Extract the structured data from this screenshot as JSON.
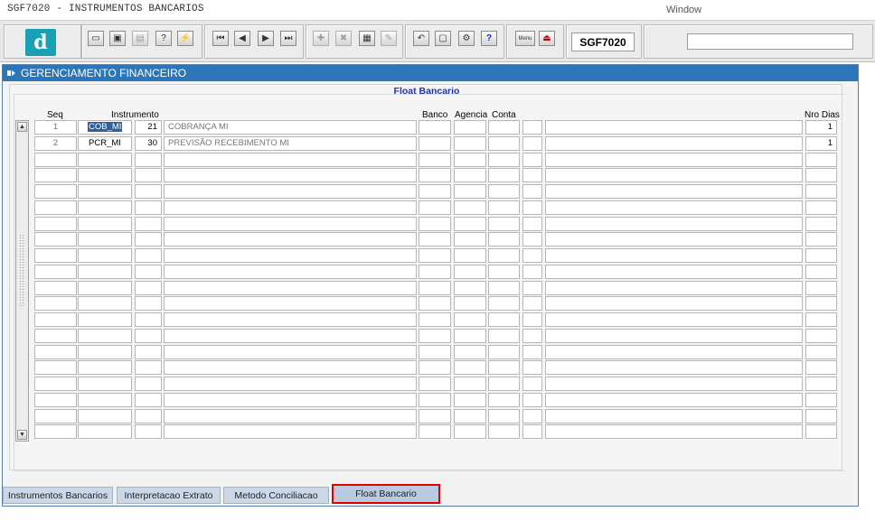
{
  "window": {
    "title": "SGF7020 - INSTRUMENTOS BANCARIOS",
    "menu_window": "Window"
  },
  "toolbar": {
    "logo_letter": "d",
    "form_code": "SGF7020",
    "search_value": "",
    "buttons": [
      {
        "name": "save-icon",
        "glyph": "▭"
      },
      {
        "name": "screen-icon",
        "glyph": "▣"
      },
      {
        "name": "print-icon",
        "glyph": "▤"
      },
      {
        "name": "query-enter-icon",
        "glyph": "?"
      },
      {
        "name": "query-execute-icon",
        "glyph": "⚡"
      },
      {
        "name": "first-record-icon",
        "glyph": "⏮"
      },
      {
        "name": "previous-record-icon",
        "glyph": "◀"
      },
      {
        "name": "next-record-icon",
        "glyph": "▶"
      },
      {
        "name": "last-record-icon",
        "glyph": "⏭"
      },
      {
        "name": "insert-record-icon",
        "glyph": "✚"
      },
      {
        "name": "delete-record-icon",
        "glyph": "✖"
      },
      {
        "name": "clear-record-icon",
        "glyph": "▦"
      },
      {
        "name": "edit-icon",
        "glyph": "✎"
      },
      {
        "name": "undo-icon",
        "glyph": "↶"
      },
      {
        "name": "list-icon",
        "glyph": "▢"
      },
      {
        "name": "tools-icon",
        "glyph": "⚙"
      },
      {
        "name": "help-icon",
        "glyph": "?"
      },
      {
        "name": "menu-icon",
        "glyph": "Menu"
      },
      {
        "name": "exit-icon",
        "glyph": "⏏"
      }
    ]
  },
  "frame": {
    "title": "GERENCIAMENTO FINANCEIRO"
  },
  "panel": {
    "title": "Float Bancario"
  },
  "columns": {
    "seq": "Seq",
    "instrumento": "Instrumento",
    "banco": "Banco",
    "agencia": "Agencia",
    "conta": "Conta",
    "nro_dias": "Nro Dias"
  },
  "rows": [
    {
      "seq": "1",
      "code": "COB_MI",
      "num": "21",
      "desc": "COBRANÇA MI",
      "banco": "",
      "agencia": "",
      "conta": "",
      "dig": "",
      "extra": "",
      "dias": "1"
    },
    {
      "seq": "2",
      "code": "PCR_MI",
      "num": "30",
      "desc": "PREVISÃO RECEBIMENTO MI",
      "banco": "",
      "agencia": "",
      "conta": "",
      "dig": "",
      "extra": "",
      "dias": "1"
    }
  ],
  "empty_rows": 18,
  "tabs": [
    {
      "label": "Instrumentos Bancarios",
      "active": false
    },
    {
      "label": "Interpretacao Extrato",
      "active": false
    },
    {
      "label": "Metodo Conciliacao",
      "active": false
    },
    {
      "label": "Float Bancario",
      "active": true
    }
  ]
}
